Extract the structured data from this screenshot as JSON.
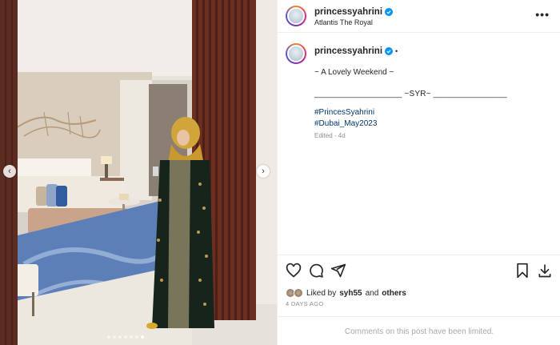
{
  "post": {
    "username": "princessyahrini",
    "location": "Atlantis The Royal",
    "caption_lines": [
      "~ A Lovely Weekend ~",
      "___________________ ~SYR~ ________________",
      "#PrincesSyahrini",
      "#Dubai_May2023"
    ],
    "edited": "Edited · 4d",
    "caption_bullet": "•"
  },
  "photo": {
    "description_icon": "photo-of-woman-in-hotel-room"
  },
  "carousel": {
    "prev": "‹",
    "next": "›",
    "slide_count": 7,
    "active_slide": 6
  },
  "engagement": {
    "liked_prefix": "Liked by",
    "liked_user": "syh55",
    "liked_and": "and",
    "liked_others": "others",
    "date": "4 DAYS AGO"
  },
  "comments_notice": "Comments on this post have been limited.",
  "more_label": "•••",
  "colors": {
    "verified": "#0095f6",
    "hashtag": "#00376b",
    "muted": "#8e8e8e"
  }
}
